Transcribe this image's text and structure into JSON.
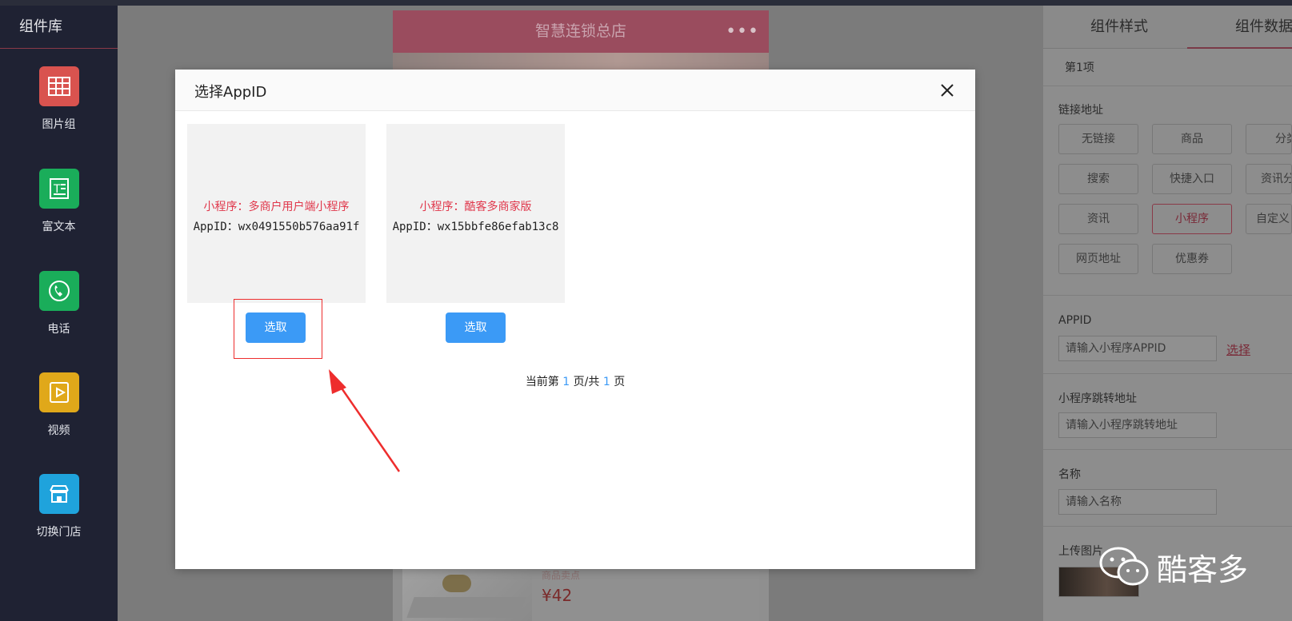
{
  "sidebar": {
    "title": "组件库",
    "items": [
      {
        "label": "图片组",
        "icon": "image-grid-icon",
        "color": "#d9534f"
      },
      {
        "label": "富文本",
        "icon": "rich-text-icon",
        "color": "#1aad5a"
      },
      {
        "label": "电话",
        "icon": "phone-icon",
        "color": "#1aad5a"
      },
      {
        "label": "视频",
        "icon": "video-icon",
        "color": "#e0a81a"
      },
      {
        "label": "切换门店",
        "icon": "store-icon",
        "color": "#1fa3dc"
      }
    ]
  },
  "phone": {
    "title": "智慧连锁总店",
    "more": "•••",
    "card_subtitle": "商品卖点",
    "card_price": "¥42"
  },
  "right_panel": {
    "tabs": [
      "组件样式",
      "组件数据"
    ],
    "item_label": "第1项",
    "link_section_title": "链接地址",
    "link_buttons": [
      "无链接",
      "商品",
      "分类",
      "搜索",
      "快捷入口",
      "资讯分类",
      "资讯",
      "小程序",
      "自定义",
      "网页地址",
      "优惠券"
    ],
    "selected_link": "小程序",
    "appid_title": "APPID",
    "appid_placeholder": "请输入小程序APPID",
    "appid_choose": "选择",
    "jump_title": "小程序跳转地址",
    "jump_placeholder": "请输入小程序跳转地址",
    "name_title": "名称",
    "name_placeholder": "请输入名称",
    "upload_title": "上传图片"
  },
  "modal": {
    "title": "选择AppID",
    "apps": [
      {
        "name": "小程序：多商户用户端小程序",
        "appid": "AppID：wx0491550b576aa91f",
        "button": "选取"
      },
      {
        "name": "小程序：酷客多商家版",
        "appid": "AppID：wx15bbfe86efab13c8",
        "button": "选取"
      }
    ],
    "pager": {
      "prefix": "当前第",
      "current": "1",
      "middle": "页/共",
      "total": "1",
      "suffix": "页"
    }
  },
  "watermark": {
    "text": "酷客多",
    "icon": "wechat-icon"
  },
  "colors": {
    "accent": "#3b9af6",
    "highlight": "#ee2d2d",
    "app_name": "#e0374b"
  }
}
